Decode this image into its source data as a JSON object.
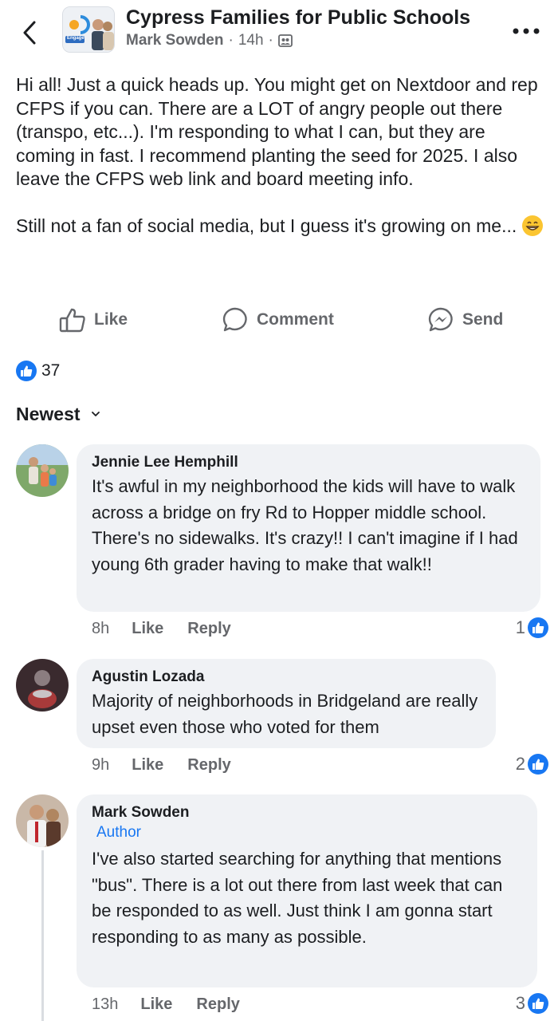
{
  "header": {
    "group_name": "Cypress Families for Public Schools",
    "author": "Mark Sowden",
    "time": "14h",
    "separator": "·",
    "avatar_caption": "Engage"
  },
  "post": {
    "paragraph1": "Hi all! Just a quick heads up. You might get on Nextdoor and rep CFPS if you can. There are a LOT of angry people out there (transpo, etc...). I'm responding to what I can, but they are coming in fast. I recommend planting the seed for 2025. I also leave the CFPS web link and board meeting info.",
    "paragraph2": "Still not a fan of social media, but I guess it's growing on me...",
    "emoji": "grinning-face"
  },
  "actions": {
    "like": "Like",
    "comment": "Comment",
    "send": "Send"
  },
  "reactions": {
    "count": "37"
  },
  "sort": {
    "label": "Newest"
  },
  "comments": [
    {
      "name": "Jennie Lee Hemphill",
      "badge": "",
      "text": "It's awful in my neighborhood the kids will have to walk across a bridge on fry Rd to Hopper middle school. There's no sidewalks. It's crazy!! I can't imagine if I had young 6th grader having to make that walk!!",
      "time": "8h",
      "like": "Like",
      "reply": "Reply",
      "reactions": "1"
    },
    {
      "name": "Agustin Lozada",
      "badge": "",
      "text": "Majority of neighborhoods in Bridgeland are really upset even those who voted for them",
      "time": "9h",
      "like": "Like",
      "reply": "Reply",
      "reactions": "2"
    },
    {
      "name": "Mark Sowden",
      "badge": "Author",
      "text": "I've also started searching for anything that mentions \"bus\". There is a lot out there from last week that can be responded to as well. Just think I am gonna start responding to as many as possible.",
      "time": "13h",
      "like": "Like",
      "reply": "Reply",
      "reactions": "3"
    }
  ],
  "colors": {
    "accent": "#1877f2",
    "text": "#1c1e21",
    "secondary": "#65676b",
    "bubble": "#f0f2f5"
  }
}
